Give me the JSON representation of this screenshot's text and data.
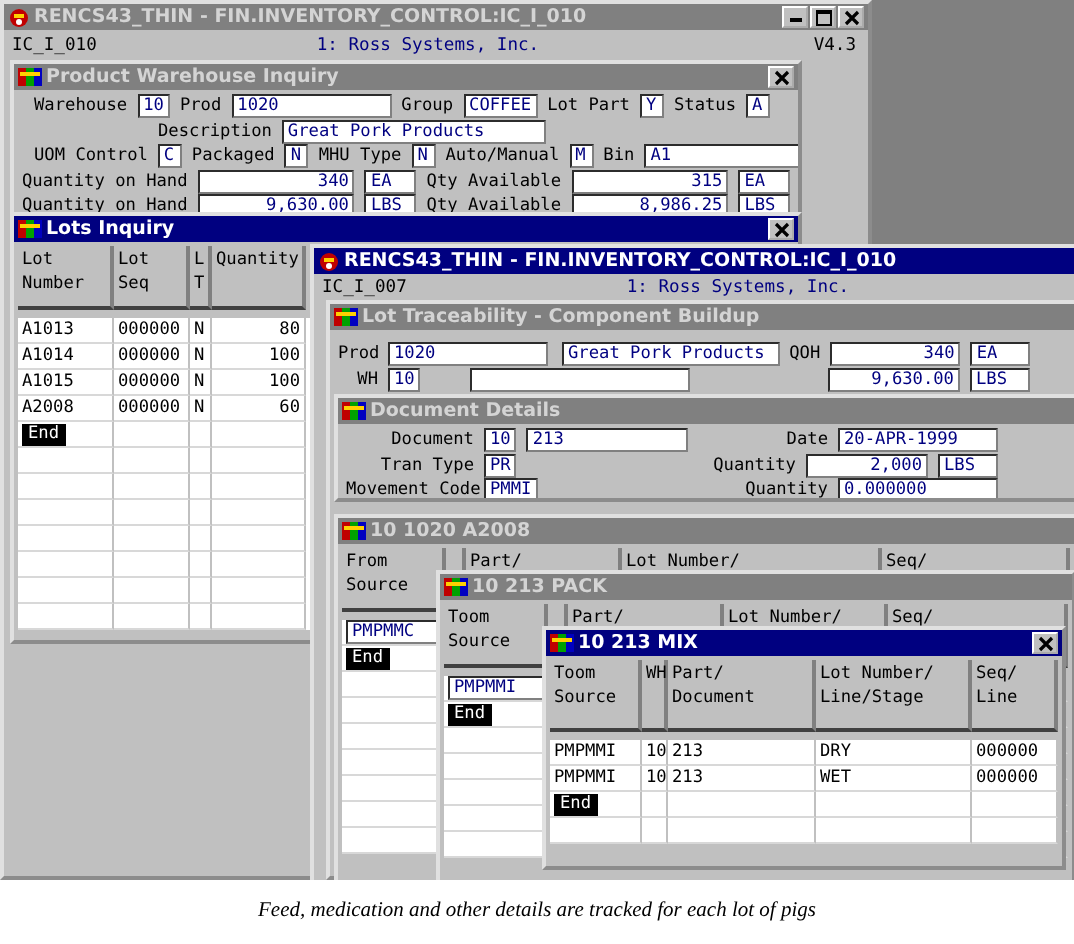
{
  "windows": [
    {
      "kind": "app",
      "title": "RENCS43_THIN - FIN.INVENTORY_CONTROL:IC_I_010",
      "active": false,
      "controls": [
        {
          "kind": "minimize"
        },
        {
          "kind": "maximize"
        },
        {
          "kind": "close"
        }
      ],
      "code": "IC_I_010",
      "company": "1: Ross Systems, Inc.",
      "version": "V4.3"
    },
    {
      "kind": "form",
      "title": "Product Warehouse Inquiry",
      "active": false,
      "controls": [
        {
          "kind": "close"
        }
      ],
      "lines": [
        {
          "items": [
            {
              "kind": "label",
              "text": "Warehouse"
            },
            {
              "kind": "code",
              "value": "10"
            },
            {
              "kind": "label",
              "text": "Prod"
            },
            {
              "kind": "text",
              "value": "1020"
            },
            {
              "kind": "label",
              "text": "Group"
            },
            {
              "kind": "code",
              "value": "COFFEE"
            },
            {
              "kind": "label",
              "text": "Lot Part"
            },
            {
              "kind": "code",
              "value": "Y"
            },
            {
              "kind": "label",
              "text": "Status"
            },
            {
              "kind": "code",
              "value": "A"
            }
          ]
        },
        {
          "items": [
            {
              "kind": "label",
              "text": "Description"
            },
            {
              "kind": "text",
              "value": "Great Pork Products"
            }
          ]
        },
        {
          "items": [
            {
              "kind": "label",
              "text": "UOM Control"
            },
            {
              "kind": "code",
              "value": "C"
            },
            {
              "kind": "label",
              "text": "Packaged"
            },
            {
              "kind": "code",
              "value": "N"
            },
            {
              "kind": "label",
              "text": "MHU Type"
            },
            {
              "kind": "code",
              "value": "N"
            },
            {
              "kind": "label",
              "text": "Auto/Manual"
            },
            {
              "kind": "code",
              "value": "M"
            },
            {
              "kind": "label",
              "text": "Bin"
            },
            {
              "kind": "text",
              "value": "A1"
            }
          ]
        },
        {
          "items": [
            {
              "kind": "label",
              "text": "Quantity on Hand"
            },
            {
              "kind": "number",
              "value": "340"
            },
            {
              "kind": "unit",
              "value": "EA"
            },
            {
              "kind": "label",
              "text": "Qty Available"
            },
            {
              "kind": "number",
              "value": "315"
            },
            {
              "kind": "unit",
              "value": "EA"
            }
          ]
        },
        {
          "items": [
            {
              "kind": "label",
              "text": "Quantity on Hand"
            },
            {
              "kind": "number",
              "value": "9,630.00"
            },
            {
              "kind": "unit",
              "value": "LBS"
            },
            {
              "kind": "label",
              "text": "Qty Available"
            },
            {
              "kind": "number",
              "value": "8,986.25"
            },
            {
              "kind": "unit",
              "value": "LBS"
            }
          ]
        }
      ]
    },
    {
      "kind": "table",
      "title": "Lots Inquiry",
      "active": true,
      "controls": [
        {
          "kind": "close"
        }
      ],
      "columns": [
        "Lot\nNumber",
        "Lot\nSeq",
        "L\nT",
        "Quantity"
      ],
      "rows": [
        [
          "A1013",
          "000000",
          "N",
          "80"
        ],
        [
          "A1014",
          "000000",
          "N",
          "100"
        ],
        [
          "A1015",
          "000000",
          "N",
          "100"
        ],
        [
          "A2008",
          "000000",
          "N",
          "60"
        ]
      ],
      "end_marker": "End"
    },
    {
      "kind": "app",
      "title": "RENCS43_THIN - FIN.INVENTORY_CONTROL:IC_I_010",
      "active": true,
      "code": "IC_I_007",
      "company": "1: Ross Systems, Inc."
    },
    {
      "kind": "form",
      "title": "Lot Traceability - Component Buildup",
      "active": false,
      "lines": [
        {
          "items": [
            {
              "kind": "label",
              "text": "Prod"
            },
            {
              "kind": "text",
              "value": "1020"
            },
            {
              "kind": "text",
              "value": "Great Pork Products"
            },
            {
              "kind": "label",
              "text": "QOH"
            },
            {
              "kind": "number",
              "value": "340"
            },
            {
              "kind": "unit",
              "value": "EA"
            }
          ]
        },
        {
          "items": [
            {
              "kind": "label",
              "text": "WH"
            },
            {
              "kind": "code",
              "value": "10"
            },
            {
              "kind": "text"
            },
            {
              "kind": "number",
              "value": "9,630.00"
            },
            {
              "kind": "unit",
              "value": "LBS"
            }
          ]
        }
      ]
    },
    {
      "kind": "form",
      "title": "Document Details",
      "active": false,
      "lines": [
        {
          "items": [
            {
              "kind": "label",
              "text": "Document"
            },
            {
              "kind": "code",
              "value": "10"
            },
            {
              "kind": "text",
              "value": "213"
            },
            {
              "kind": "label",
              "text": "Date"
            },
            {
              "kind": "text",
              "value": "20-APR-1999"
            }
          ]
        },
        {
          "items": [
            {
              "kind": "label",
              "text": "Tran Type"
            },
            {
              "kind": "code",
              "value": "PR"
            },
            {
              "kind": "label",
              "text": "Quantity"
            },
            {
              "kind": "number",
              "value": "2,000"
            },
            {
              "kind": "unit",
              "value": "LBS"
            }
          ]
        },
        {
          "items": [
            {
              "kind": "label",
              "text": "Movement Code"
            },
            {
              "kind": "code",
              "value": "PMMI"
            },
            {
              "kind": "label",
              "text": "Quantity"
            },
            {
              "kind": "text",
              "value": "0.000000"
            }
          ]
        }
      ]
    },
    {
      "kind": "trace",
      "title": "10 1020 A2008",
      "active": false,
      "columns": [
        "From\nSource",
        "",
        "Part/",
        "Lot Number/",
        "Seq/"
      ],
      "entry": "PMPMMC",
      "end_marker": "End"
    },
    {
      "kind": "trace",
      "title": "10 213 PACK",
      "active": false,
      "columns": [
        "Toom\nSource",
        "",
        "Part/",
        "Lot Number/",
        "Seq/"
      ],
      "entry": "PMPMMI",
      "end_marker": "End"
    },
    {
      "kind": "trace",
      "title": "10 213 MIX",
      "active": true,
      "controls": [
        {
          "kind": "close"
        }
      ],
      "columns": [
        "Toom\nSource",
        "WH",
        "Part/\nDocument",
        "Lot Number/\nLine/Stage",
        "Seq/\nLine"
      ],
      "rows": [
        [
          "PMPMMI",
          "10",
          "213",
          "DRY",
          "000000"
        ],
        [
          "PMPMMI",
          "10",
          "213",
          "WET",
          "000000"
        ]
      ],
      "end_marker": "End"
    }
  ],
  "caption": "Feed, medication and other details are tracked for each lot of pigs"
}
